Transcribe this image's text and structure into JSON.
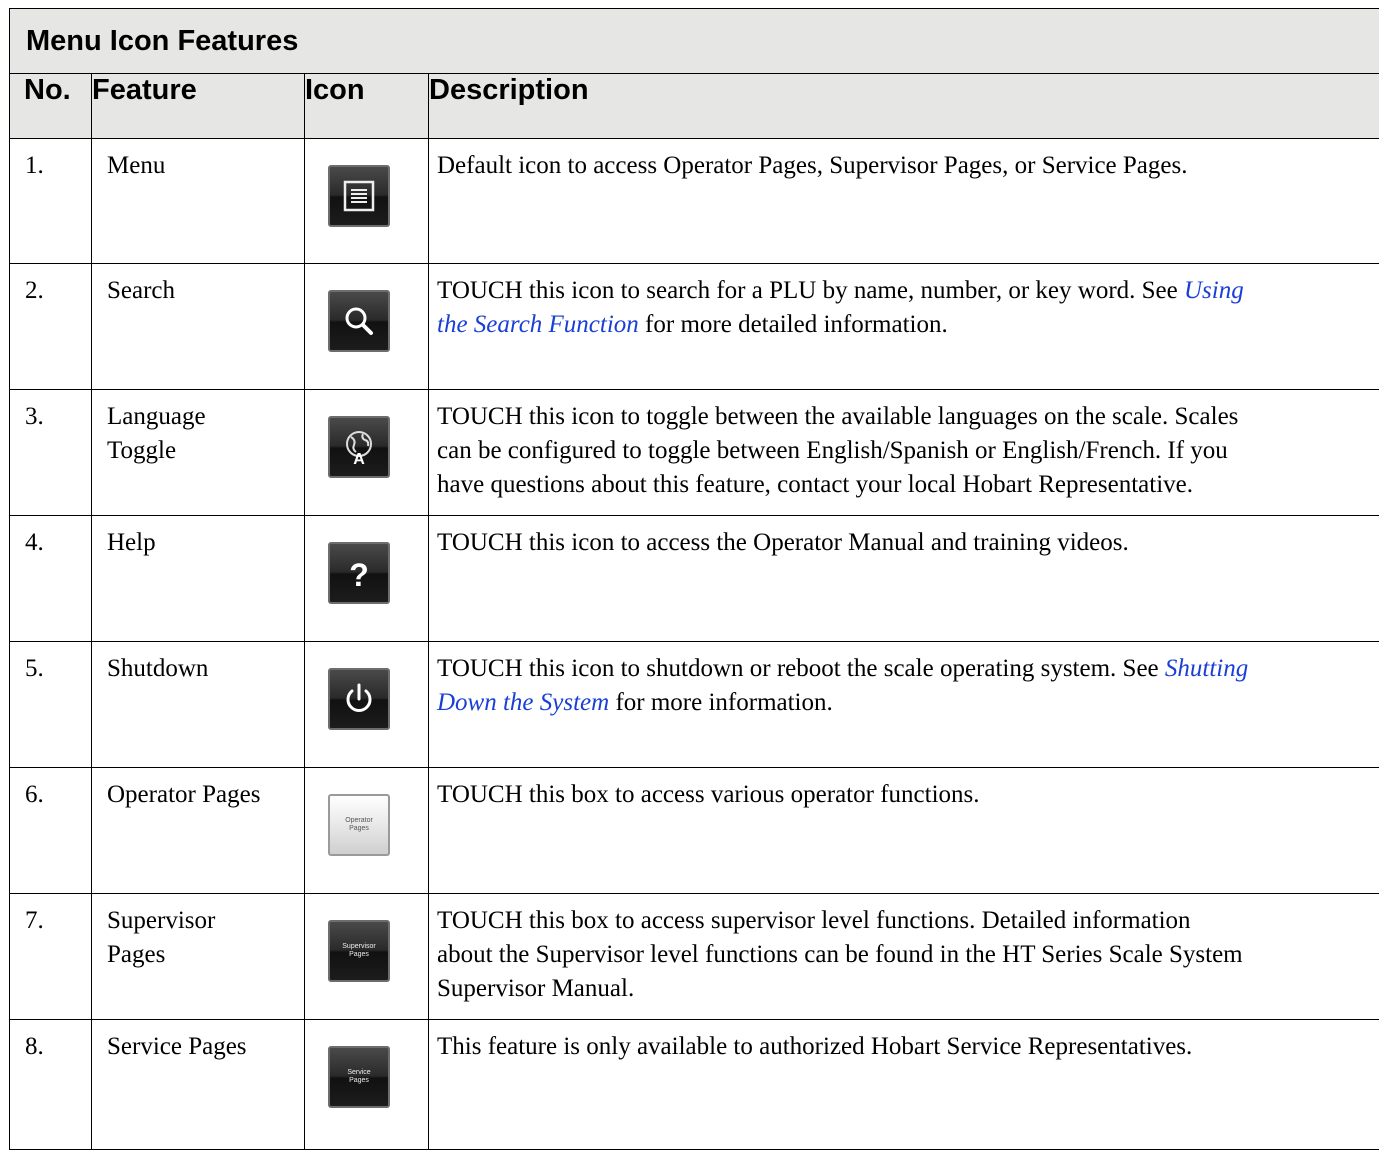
{
  "table": {
    "title": "Menu Icon Features",
    "headers": {
      "no": "No.",
      "feature": "Feature",
      "icon": "Icon",
      "description": "Description"
    },
    "rows": [
      {
        "no": "1.",
        "feature": "Menu",
        "icon": "menu-icon",
        "description": "Default icon to access Operator Pages, Supervisor Pages, or Service Pages."
      },
      {
        "no": "2.",
        "feature": "Search",
        "icon": "search-icon",
        "desc_pre": "TOUCH this icon to search for a PLU by name, number, or key word. See ",
        "desc_link_a": "Using",
        "desc_link_b": "the Search Function",
        "desc_post": " for more detailed information."
      },
      {
        "no": "3.",
        "feature_line1": "Language",
        "feature_line2": "Toggle",
        "icon": "globe-language-icon",
        "desc_line1": "TOUCH this icon to toggle between the available languages on the scale. Scales",
        "desc_line2": "can be configured to toggle between English/Spanish or English/French. If you",
        "desc_line3": "have questions about this feature, contact your local Hobart Representative."
      },
      {
        "no": "4.",
        "feature": "Help",
        "icon": "help-icon",
        "description": "TOUCH this icon to access the Operator Manual and training videos."
      },
      {
        "no": "5.",
        "feature": "Shutdown",
        "icon": "power-icon",
        "desc_pre": "TOUCH this icon to shutdown or reboot the scale operating system. See ",
        "desc_link_a": "Shutting",
        "desc_link_b": "Down the System",
        "desc_post": " for more information."
      },
      {
        "no": "6.",
        "feature": "Operator Pages",
        "icon": "operator-pages-button-icon",
        "icon_text_1": "Operator",
        "icon_text_2": "Pages",
        "description": "TOUCH this box to access various operator functions."
      },
      {
        "no": "7.",
        "feature_line1": "Supervisor",
        "feature_line2": "Pages",
        "icon": "supervisor-pages-button-icon",
        "icon_text_1": "Supervisor",
        "icon_text_2": "Pages",
        "desc_line1": "TOUCH this box to access supervisor level functions. Detailed information",
        "desc_line2": "about the Supervisor level functions can be found in the HT Series Scale System",
        "desc_line3": "Supervisor Manual."
      },
      {
        "no": "8.",
        "feature": "Service Pages",
        "icon": "service-pages-button-icon",
        "icon_text_1": "Service",
        "icon_text_2": "Pages",
        "description": "This feature is only available to authorized Hobart Service Representatives."
      }
    ]
  },
  "colors": {
    "header_bg": "#e6e6e4",
    "link": "#1a3fd6",
    "border": "#000000"
  }
}
